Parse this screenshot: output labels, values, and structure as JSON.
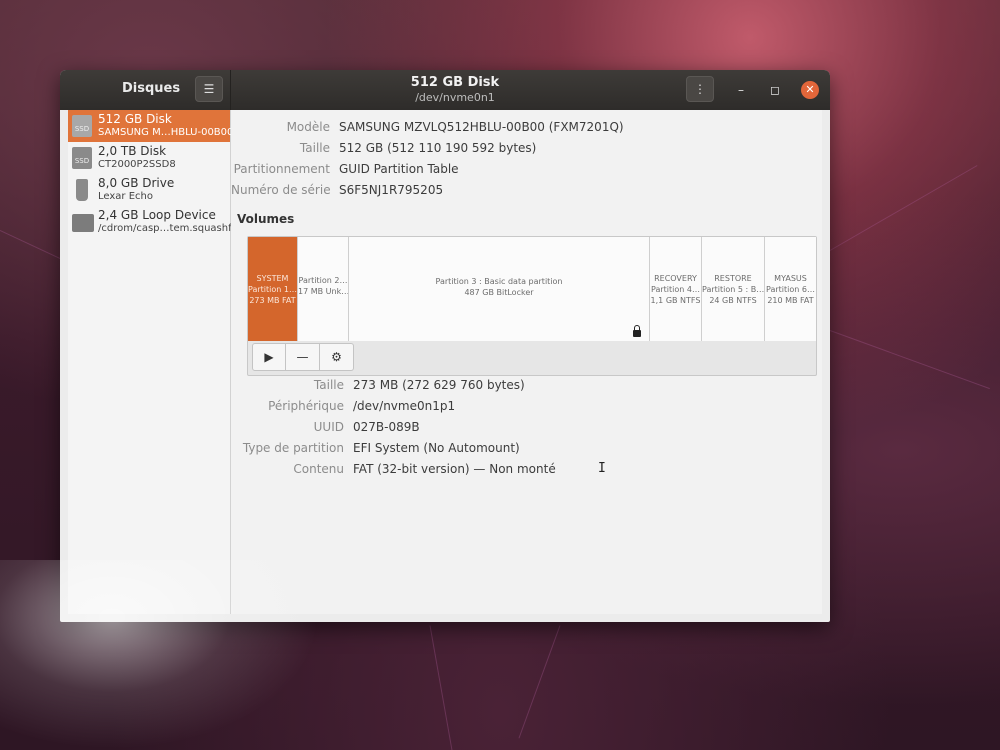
{
  "app": {
    "sidebar_title": "Disques",
    "title": "512 GB Disk",
    "subtitle": "/dev/nvme0n1"
  },
  "window_controls": {
    "menu": "⋮",
    "minimize": "–",
    "maximize": "◻",
    "close": "✕"
  },
  "sidebar": {
    "items": [
      {
        "name": "512 GB Disk",
        "sub": "SAMSUNG M…HBLU-00B00",
        "icon": "ssd-icon",
        "icon_text": "SSD",
        "selected": true
      },
      {
        "name": "2,0 TB Disk",
        "sub": "CT2000P2SSD8",
        "icon": "ssd-icon",
        "icon_text": "SSD",
        "selected": false
      },
      {
        "name": "8,0 GB Drive",
        "sub": "Lexar Echo",
        "icon": "usb-drive-icon",
        "icon_text": "",
        "selected": false
      },
      {
        "name": "2,4 GB Loop Device",
        "sub": "/cdrom/casp…tem.squashfs",
        "icon": "loop-device-icon",
        "icon_text": "",
        "selected": false
      }
    ]
  },
  "disk_props": [
    {
      "label": "Modèle",
      "value": "SAMSUNG MZVLQ512HBLU-00B00 (FXM7201Q)"
    },
    {
      "label": "Taille",
      "value": "512 GB (512 110 190 592 bytes)"
    },
    {
      "label": "Partitionnement",
      "value": "GUID Partition Table"
    },
    {
      "label": "Numéro de série",
      "value": "S6F5NJ1R795205"
    }
  ],
  "volumes_title": "Volumes",
  "partitions": [
    {
      "l1": "SYSTEM",
      "l2": "Partition 1…",
      "l3": "273 MB FAT",
      "selected": true
    },
    {
      "l1": "",
      "l2": "Partition 2…",
      "l3": "17 MB Unk…",
      "selected": false
    },
    {
      "l1": "",
      "l2": "Partition 3 : Basic data partition",
      "l3": "487 GB BitLocker",
      "selected": false,
      "locked": true
    },
    {
      "l1": "RECOVERY",
      "l2": "Partition 4…",
      "l3": "1,1 GB NTFS",
      "selected": false
    },
    {
      "l1": "RESTORE",
      "l2": "Partition 5 : B…",
      "l3": "24 GB NTFS",
      "selected": false
    },
    {
      "l1": "MYASUS",
      "l2": "Partition 6…",
      "l3": "210 MB FAT",
      "selected": false
    }
  ],
  "vol_toolbar": {
    "play": "▶",
    "minus": "—",
    "gear": "⚙"
  },
  "partition_props": [
    {
      "label": "Taille",
      "value": "273 MB (272 629 760 bytes)"
    },
    {
      "label": "Périphérique",
      "value": "/dev/nvme0n1p1"
    },
    {
      "label": "UUID",
      "value": "027B-089B"
    },
    {
      "label": "Type de partition",
      "value": "EFI System (No Automount)"
    },
    {
      "label": "Contenu",
      "value": "FAT (32-bit version) — Non monté"
    }
  ],
  "colors": {
    "accent": "#e0743a",
    "headerbar": "#2e2c2a",
    "close_button": "#e2663a"
  }
}
